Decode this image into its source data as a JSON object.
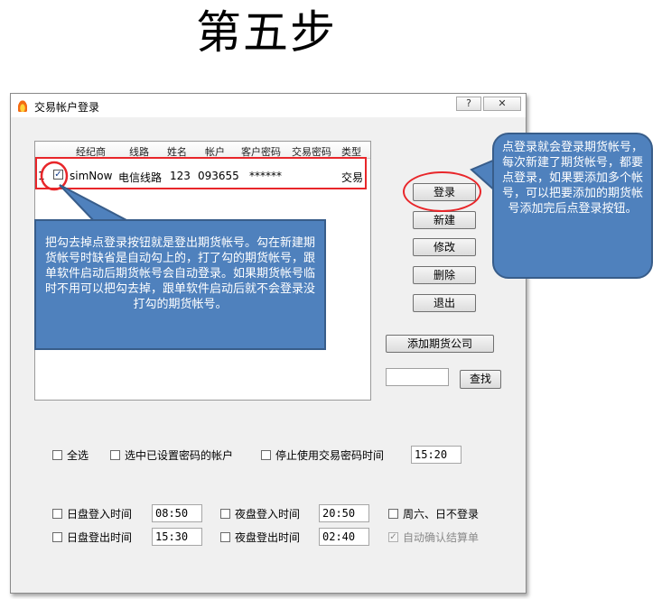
{
  "page": {
    "heading": "第五步"
  },
  "window": {
    "title": "交易帐户登录",
    "help_label": "?",
    "close_label": "✕"
  },
  "grid": {
    "columns": [
      "经纪商",
      "线路",
      "姓名",
      "帐户",
      "客户密码",
      "交易密码",
      "类型"
    ],
    "rows": [
      {
        "index": "1",
        "checked": true,
        "broker": "simNow",
        "route": "电信线路",
        "name": "123",
        "account": "093655",
        "client_password": "******",
        "trade_password": "",
        "type": "交易"
      }
    ]
  },
  "buttons": {
    "login": "登录",
    "new": "新建",
    "edit": "修改",
    "delete": "删除",
    "exit": "退出",
    "add_company": "添加期货公司",
    "find": "查找"
  },
  "search": {
    "value": ""
  },
  "options": {
    "select_all": "全选",
    "select_with_password": "选中已设置密码的帐户",
    "stop_trade_password_time": "停止使用交易密码时间",
    "stop_time_value": "15:20",
    "day_login_time": "日盘登入时间",
    "day_login_value": "08:50",
    "night_login_time": "夜盘登入时间",
    "night_login_value": "20:50",
    "weekend_no_login": "周六、日不登录",
    "day_logout_time": "日盘登出时间",
    "day_logout_value": "15:30",
    "night_logout_time": "夜盘登出时间",
    "night_logout_value": "02:40",
    "auto_confirm": "自动确认结算单"
  },
  "callouts": {
    "left": "把勾去掉点登录按钮就是登出期货帐号。勾在新建期货帐号时缺省是自动勾上的，打了勾的期货帐号，跟单软件启动后期货帐号会自动登录。如果期货帐号临时不用可以把勾去掉，跟单软件启动后就不会登录没打勾的期货帐号。",
    "right": "点登录就会登录期货帐号，每次新建了期货帐号，都要点登录，如果要添加多个帐号，可以把要添加的期货帐号添加完后点登录按钮。"
  },
  "colors": {
    "callout_fill": "#4f81bd",
    "annotation_red": "#e8262a"
  }
}
